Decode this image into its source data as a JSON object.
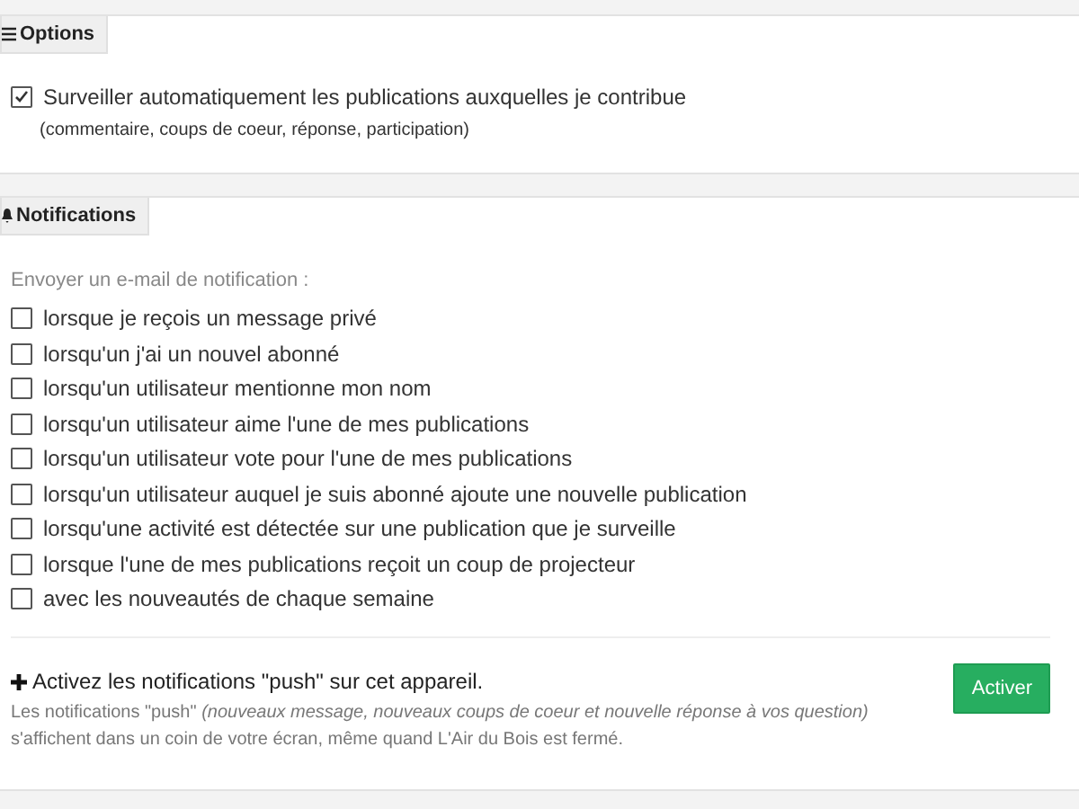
{
  "options": {
    "tab": "Options",
    "items": [
      {
        "label": "Surveiller automatiquement les publications auxquelles je contribue",
        "hint": "(commentaire, coups de coeur, réponse, participation)",
        "checked": true
      }
    ]
  },
  "notifications": {
    "tab": "Notifications",
    "intro": "Envoyer un e-mail de notification :",
    "items": [
      {
        "label": "lorsque je reçois un message privé",
        "checked": false
      },
      {
        "label": "lorsqu'un j'ai un nouvel abonné",
        "checked": false
      },
      {
        "label": "lorsqu'un utilisateur mentionne mon nom",
        "checked": false
      },
      {
        "label": "lorsqu'un utilisateur aime l'une de mes publications",
        "checked": false
      },
      {
        "label": "lorsqu'un utilisateur vote pour l'une de mes publications",
        "checked": false
      },
      {
        "label": "lorsqu'un utilisateur auquel je suis abonné ajoute une nouvelle publication",
        "checked": false
      },
      {
        "label": "lorsqu'une activité est détectée sur une publication que je surveille",
        "checked": false
      },
      {
        "label": "lorsque l'une de mes publications reçoit un coup de projecteur",
        "checked": false
      },
      {
        "label": "avec les nouveautés de chaque semaine",
        "checked": false
      }
    ],
    "push": {
      "title": "Activez les notifications \"push\" sur cet appareil.",
      "description": "Les notifications \"push\" *(nouveaux message, nouveaux coups de coeur et nouvelle réponse à vos question)* s'affichent dans un coin de votre écran, même quand L'Air du Bois est fermé.",
      "button": "Activer"
    }
  }
}
